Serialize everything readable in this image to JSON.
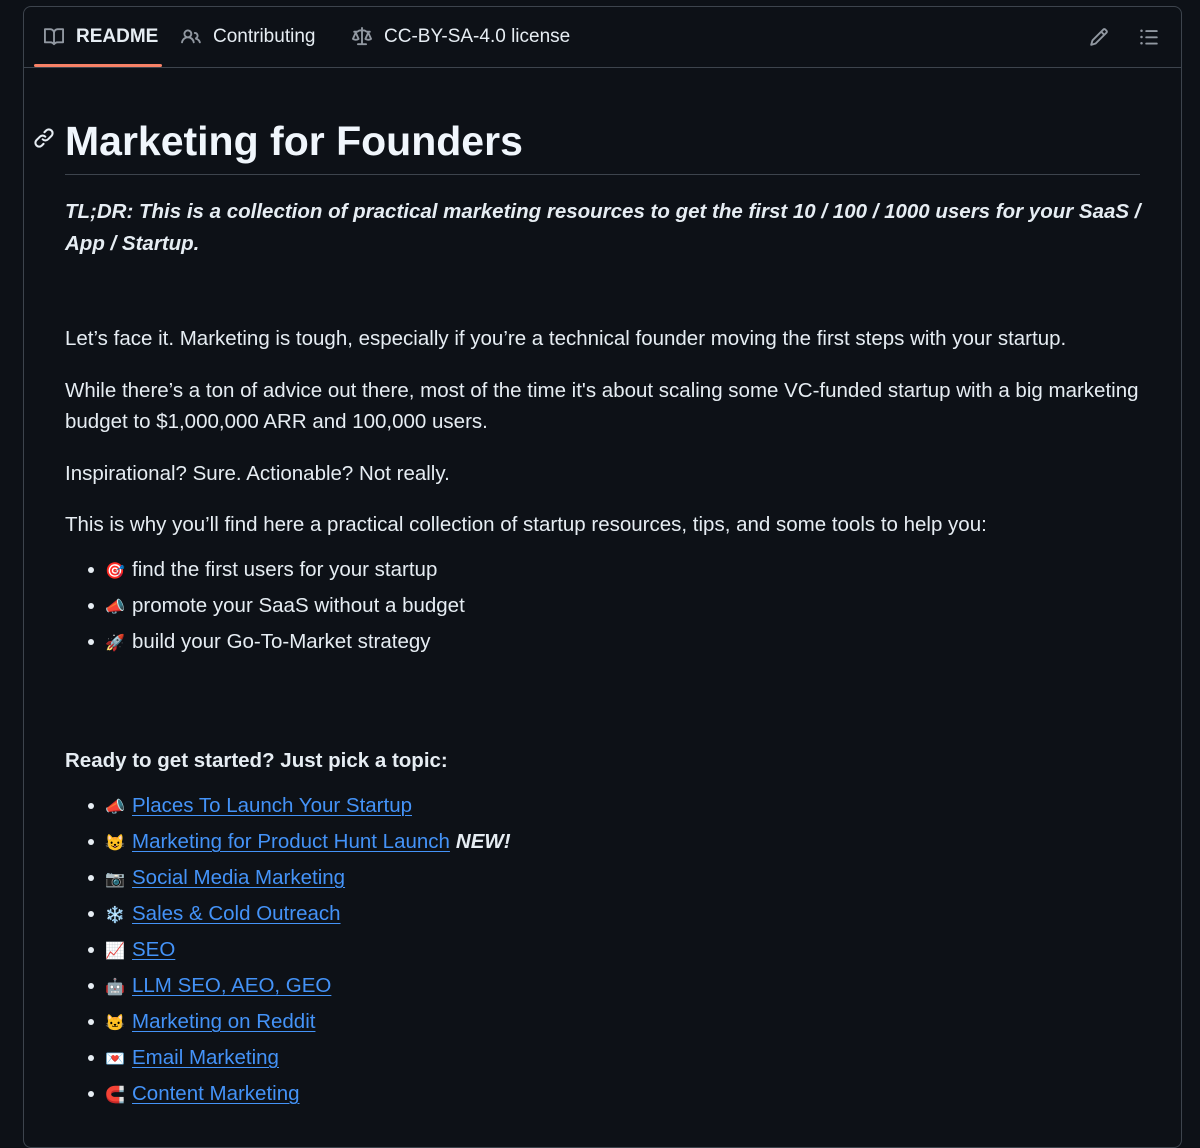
{
  "tabs": [
    {
      "label": "README",
      "icon": "book-icon",
      "active": true
    },
    {
      "label": "Contributing",
      "icon": "people-icon",
      "active": false
    },
    {
      "label": "CC-BY-SA-4.0 license",
      "icon": "scale-icon",
      "active": false
    }
  ],
  "toolbar": {
    "edit_icon": "pencil-icon",
    "outline_icon": "list-icon"
  },
  "readme": {
    "title": "Marketing for Founders",
    "tldr": "TL;DR: This is a collection of practical marketing resources to get the first 10 / 100 / 1000 users for your SaaS / App / Startup.",
    "p1": "Let’s face it. Marketing is tough, especially if you’re a technical founder moving the first steps with your startup.",
    "p2": "While there’s a ton of advice out there, most of the time it's about scaling some VC-funded startup with a big marketing budget to $1,000,000 ARR and 100,000 users.",
    "p3": "Inspirational? Sure. Actionable? Not really.",
    "p4": "This is why you’ll find here a practical collection of startup resources, tips, and some tools to help you:",
    "bullets": [
      {
        "emoji": "🎯",
        "text": "find the first users for your startup"
      },
      {
        "emoji": "📣",
        "text": "promote your SaaS without a budget"
      },
      {
        "emoji": "🚀",
        "text": "build your Go-To-Market strategy"
      }
    ],
    "topics_heading": "Ready to get started? Just pick a topic:",
    "topics": [
      {
        "emoji": "📣",
        "text": "Places To Launch Your Startup",
        "tag": ""
      },
      {
        "emoji": "😺",
        "text": "Marketing for Product Hunt Launch",
        "tag": "NEW!"
      },
      {
        "emoji": "📷",
        "text": "Social Media Marketing",
        "tag": ""
      },
      {
        "emoji": "❄️",
        "text": "Sales & Cold Outreach",
        "tag": ""
      },
      {
        "emoji": "📈",
        "text": "SEO",
        "tag": ""
      },
      {
        "emoji": "🤖",
        "text": "LLM SEO, AEO, GEO",
        "tag": ""
      },
      {
        "emoji": "🐱",
        "text": "Marketing on Reddit",
        "tag": ""
      },
      {
        "emoji": "💌",
        "text": "Email Marketing",
        "tag": ""
      },
      {
        "emoji": "🧲",
        "text": "Content Marketing",
        "tag": ""
      }
    ]
  }
}
